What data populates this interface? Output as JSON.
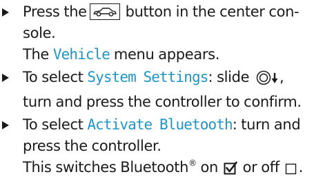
{
  "steps": [
    {
      "bullet_icon": "triangle-bullet-icon",
      "text_before": "Press the",
      "button_icon": "car-button-icon",
      "text_after_line1": "button in the center con-",
      "text_after_line2": "sole.",
      "result_prefix": "The ",
      "result_menu": "Vehicle",
      "result_suffix": " menu appears."
    },
    {
      "bullet_icon": "triangle-bullet-icon",
      "prefix": "To select ",
      "highlight": "System Settings",
      "middle": ": slide ",
      "controller_icon": "controller-slide-down-icon",
      "suffix": ",",
      "line2": "turn and press the controller to confirm."
    },
    {
      "bullet_icon": "triangle-bullet-icon",
      "prefix": "To select ",
      "highlight": "Activate Bluetooth",
      "suffix": ": turn and",
      "line2": "press the controller.",
      "result_before": "This switches Bluetooth",
      "registered_mark": "®",
      "result_on": " on ",
      "checked_icon": "checkbox-checked-icon",
      "result_off": " or off ",
      "unchecked_icon": "checkbox-unchecked-icon",
      "result_end": "."
    }
  ],
  "colors": {
    "text": "#1a1a1a",
    "highlight": "#1f95c6",
    "background": "#ffffff"
  }
}
